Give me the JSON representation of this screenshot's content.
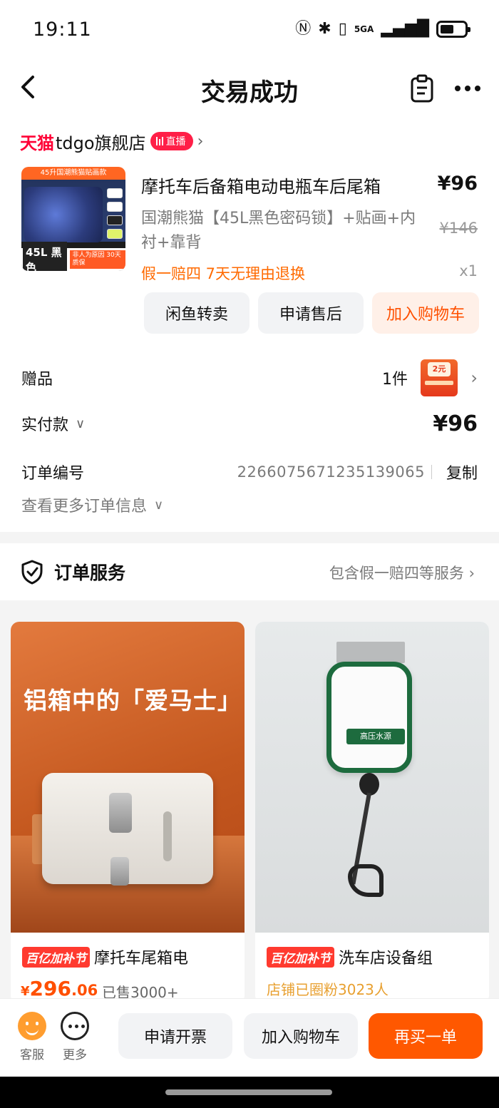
{
  "status_bar": {
    "time": "19:11",
    "network": "5GA",
    "battery_level": 0.55
  },
  "nav": {
    "title": "交易成功"
  },
  "store": {
    "platform": "天猫",
    "name": "tdgo旗舰店",
    "live_label": "直播"
  },
  "product": {
    "thumb_banner": "45升国潮熊猫贴画款",
    "thumb_size": "45L 黑色",
    "thumb_note": "非人为原因 30天质保",
    "title": "摩托车后备箱电动电瓶车后尾箱",
    "price": "¥96",
    "sku": "国潮熊猫【45L黑色密码锁】+贴画+内衬+靠背",
    "original_price": "¥146",
    "guarantee": "假一赔四  7天无理由退换",
    "quantity": "x1"
  },
  "actions": {
    "resell": "闲鱼转卖",
    "after_sale": "申请售后",
    "add_cart": "加入购物车"
  },
  "gift": {
    "label": "赠品",
    "count": "1件",
    "badge": "2元"
  },
  "payment": {
    "label": "实付款",
    "amount": "¥96"
  },
  "order": {
    "number_label": "订单编号",
    "number": "2266075671235139065",
    "copy": "复制",
    "more_info": "查看更多订单信息"
  },
  "service": {
    "title": "订单服务",
    "desc": "包含假一赔四等服务"
  },
  "recommendations": [
    {
      "headline": "铝箱中的「爱马士」",
      "promo": "百亿加补节",
      "name": "摩托车尾箱电",
      "price_symbol": "¥",
      "price_int": "296",
      "price_dec": ".06",
      "sold": "已售3000+"
    },
    {
      "label": "高压水源",
      "promo": "百亿加补节",
      "name": "洗车店设备组",
      "fans": "店铺已圈粉3023人"
    }
  ],
  "bottom_bar": {
    "service": "客服",
    "more": "更多",
    "invoice": "申请开票",
    "add_cart": "加入购物车",
    "rebuy": "再买一单"
  },
  "colors": {
    "brand_orange": "#ff5800",
    "tmall_red": "#ff0036",
    "promo_red": "#ff3a2f",
    "guarantee_orange": "#ff6a00"
  }
}
